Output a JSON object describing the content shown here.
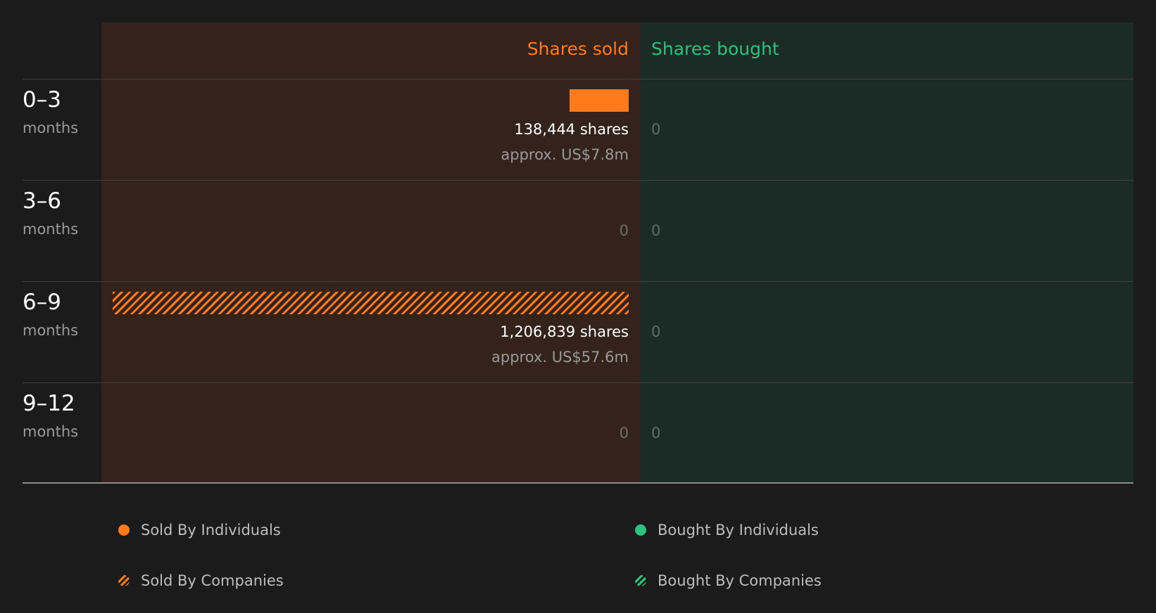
{
  "chart_data": {
    "type": "bar",
    "orientation": "horizontal-diverging",
    "headers": {
      "sold": "Shares sold",
      "bought": "Shares bought"
    },
    "categories": [
      {
        "period": "0–3",
        "unit": "months"
      },
      {
        "period": "3–6",
        "unit": "months"
      },
      {
        "period": "6–9",
        "unit": "months"
      },
      {
        "period": "9–12",
        "unit": "months"
      }
    ],
    "rows": [
      {
        "sold_shares": 138444,
        "sold_by": "individuals",
        "sold_label": "138,444 shares",
        "sold_value_label": "approx. US$7.8m",
        "bought_label": "0"
      },
      {
        "sold_shares": 0,
        "sold_by": null,
        "sold_label": "0",
        "sold_value_label": "",
        "bought_label": "0"
      },
      {
        "sold_shares": 1206839,
        "sold_by": "companies",
        "sold_label": "1,206,839 shares",
        "sold_value_label": "approx. US$57.6m",
        "bought_label": "0"
      },
      {
        "sold_shares": 0,
        "sold_by": null,
        "sold_label": "0",
        "sold_value_label": "",
        "bought_label": "0"
      }
    ],
    "series": [
      {
        "name": "Sold By Individuals",
        "values": [
          138444,
          0,
          0,
          0
        ]
      },
      {
        "name": "Sold By Companies",
        "values": [
          0,
          0,
          1206839,
          0
        ]
      },
      {
        "name": "Bought By Individuals",
        "values": [
          0,
          0,
          0,
          0
        ]
      },
      {
        "name": "Bought By Companies",
        "values": [
          0,
          0,
          0,
          0
        ]
      }
    ],
    "xlim": [
      0,
      1206839
    ],
    "grid": false,
    "legend": {
      "placement": "bottom",
      "items": [
        {
          "label": "Sold By Individuals",
          "marker": "solid-orange-dot"
        },
        {
          "label": "Bought By Individuals",
          "marker": "solid-green-dot"
        },
        {
          "label": "Sold By Companies",
          "marker": "hatched-orange-dot"
        },
        {
          "label": "Bought By Companies",
          "marker": "hatched-green-dot"
        }
      ]
    },
    "colors": {
      "sold": "#ff7a1a",
      "bought": "#2ec27e",
      "sold_panel": "#33231b",
      "bought_panel": "#1b2b25",
      "background": "#1b1b1b"
    }
  }
}
